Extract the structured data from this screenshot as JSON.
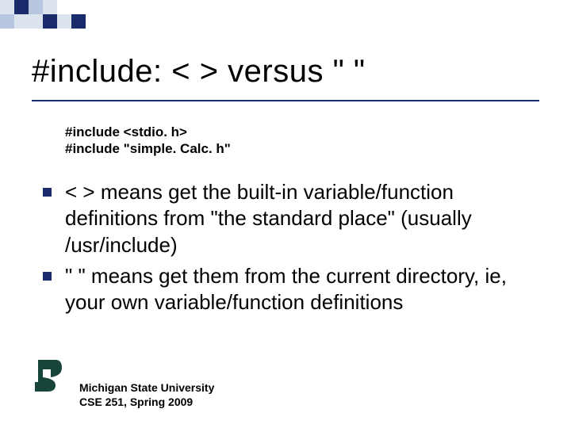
{
  "title": "#include: < > versus \" \"",
  "code": {
    "line1": "#include <stdio. h>",
    "line2": "#include \"simple. Calc. h\""
  },
  "bullets": [
    "< > means get the built-in variable/function definitions from \"the standard place\" (usually /usr/include)",
    "\" \" means get them from the current directory, ie, your own variable/function definitions"
  ],
  "footer": {
    "line1": "Michigan State University",
    "line2": "CSE 251, Spring 2009"
  }
}
